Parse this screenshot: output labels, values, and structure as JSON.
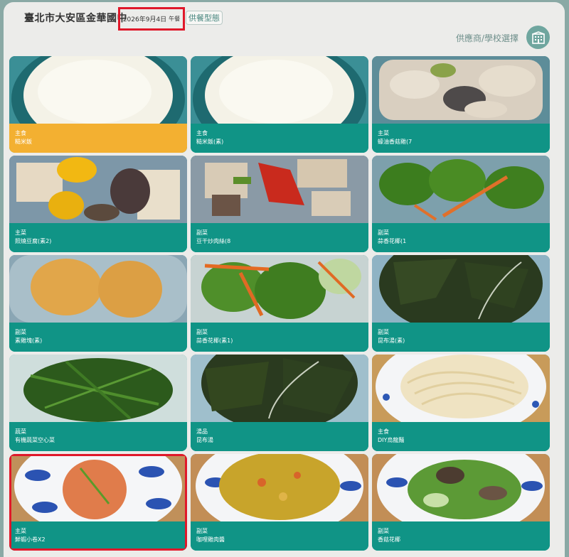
{
  "header": {
    "school": "臺北市大安區金華國中",
    "date": "2026年9月4日",
    "meal": "午餐",
    "type_button": "供餐型態",
    "supplier_link": "供應商/學校選擇",
    "supplier_icon": "school-building-icon"
  },
  "colors": {
    "teal": "#109486",
    "highlight": "#f3b031",
    "red_box": "#e0182a"
  },
  "cards": [
    {
      "category": "主食",
      "name": "糙米飯",
      "photo": "rice-bowl-photo"
    },
    {
      "category": "主食",
      "name": "糙米飯(素)",
      "photo": "rice-bowl-photo"
    },
    {
      "category": "主菜",
      "name": "蠔油香菇雞(7",
      "photo": "chicken-mushroom-photo"
    },
    {
      "category": "主菜",
      "name": "照燒豆腐(素2)",
      "photo": "tofu-peppers-photo"
    },
    {
      "category": "副菜",
      "name": "豆干炒肉絲(8",
      "photo": "tofu-stirfry-photo"
    },
    {
      "category": "副菜",
      "name": "蒜香花椰(1",
      "photo": "broccoli-photo"
    },
    {
      "category": "副菜",
      "name": "素雞塊(素)",
      "photo": "fried-patty-photo"
    },
    {
      "category": "副菜",
      "name": "蒜香花椰(素1)",
      "photo": "broccoli-carrot-photo"
    },
    {
      "category": "副菜",
      "name": "昆布湯(素)",
      "photo": "seaweed-soup-photo"
    },
    {
      "category": "蔬菜",
      "name": "有機蔬菜空心菜",
      "photo": "greens-photo"
    },
    {
      "category": "湯品",
      "name": "昆布湯",
      "photo": "seaweed-soup-photo"
    },
    {
      "category": "主食",
      "name": "DIY烏龍麵",
      "photo": "udon-noodles-photo"
    },
    {
      "category": "主菜",
      "name": "鮮蝦小卷X2",
      "photo": "seafood-plate-photo"
    },
    {
      "category": "副菜",
      "name": "咖哩雞肉醬",
      "photo": "curry-plate-photo"
    },
    {
      "category": "副菜",
      "name": "香菇花椰",
      "photo": "mushroom-broccoli-photo"
    }
  ]
}
